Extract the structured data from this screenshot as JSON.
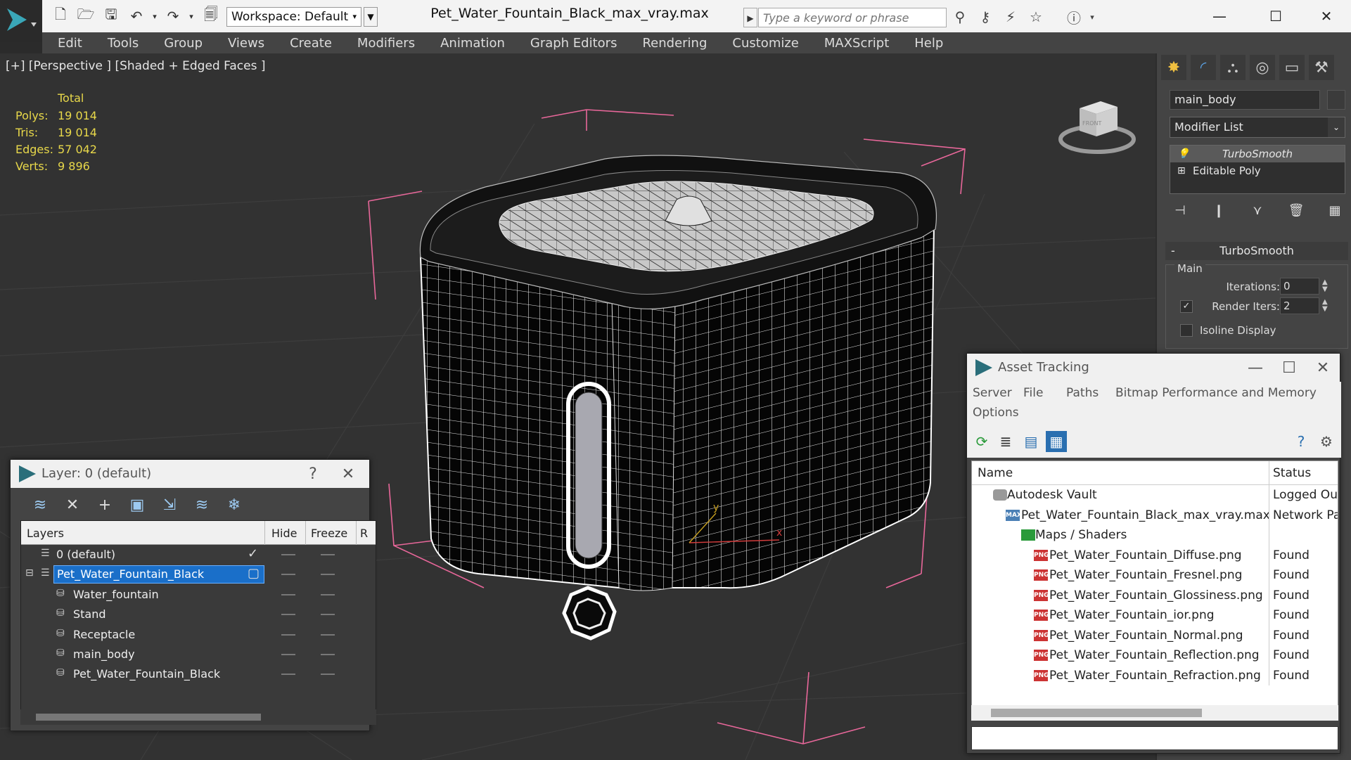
{
  "titlebar": {
    "workspace": "Workspace: Default",
    "document_title": "Pet_Water_Fountain_Black_max_vray.max",
    "search_placeholder": "Type a keyword or phrase"
  },
  "menubar": [
    "Edit",
    "Tools",
    "Group",
    "Views",
    "Create",
    "Modifiers",
    "Animation",
    "Graph Editors",
    "Rendering",
    "Customize",
    "MAXScript",
    "Help"
  ],
  "viewport": {
    "label": "[+] [Perspective ] [Shaded + Edged Faces ]",
    "stats": {
      "header": "Total",
      "rows": [
        {
          "k": "Polys:",
          "v": "19 014"
        },
        {
          "k": "Tris:",
          "v": "19 014"
        },
        {
          "k": "Edges:",
          "v": "57 042"
        },
        {
          "k": "Verts:",
          "v": "9 896"
        }
      ]
    },
    "viewcube_label": "FRONT",
    "axis_x": "x",
    "axis_y": "y",
    "colors": {
      "stats": "#e8d84a",
      "bbox": "#e8679a",
      "wire": "#ffffff"
    }
  },
  "command_panel": {
    "object_name": "main_body",
    "modifier_list": "Modifier List",
    "stack": [
      "TurboSmooth",
      "Editable Poly"
    ],
    "rollout_title": "TurboSmooth",
    "rollout_collapse": "-",
    "group": "Main",
    "iterations_label": "Iterations:",
    "iterations": "0",
    "render_iters_label": "Render Iters:",
    "render_iters": "2",
    "isoline_label": "Isoline Display"
  },
  "layer_dialog": {
    "title": "Layer: 0 (default)",
    "help": "?",
    "columns": {
      "layers": "Layers",
      "hide": "Hide",
      "freeze": "Freeze",
      "r": "R"
    },
    "rows": [
      {
        "name": "0 (default)",
        "indent": 0,
        "type": "layer",
        "current": true
      },
      {
        "name": "Pet_Water_Fountain_Black",
        "indent": 0,
        "type": "layer",
        "selected": true
      },
      {
        "name": "Water_fountain",
        "indent": 1,
        "type": "object"
      },
      {
        "name": "Stand",
        "indent": 1,
        "type": "object"
      },
      {
        "name": "Receptacle",
        "indent": 1,
        "type": "object"
      },
      {
        "name": "main_body",
        "indent": 1,
        "type": "object"
      },
      {
        "name": "Pet_Water_Fountain_Black",
        "indent": 1,
        "type": "object"
      }
    ]
  },
  "asset_dialog": {
    "title": "Asset Tracking",
    "menu": [
      "Server",
      "File",
      "Paths",
      "Bitmap Performance and Memory",
      "Options"
    ],
    "columns": {
      "name": "Name",
      "status": "Status"
    },
    "rows": [
      {
        "name": "Autodesk Vault",
        "status": "Logged Out",
        "indent": 1,
        "icon": "srv"
      },
      {
        "name": "Pet_Water_Fountain_Black_max_vray.max",
        "status": "Network Path",
        "indent": 2,
        "icon": "max"
      },
      {
        "name": "Maps / Shaders",
        "status": "",
        "indent": 3,
        "icon": "fld"
      },
      {
        "name": "Pet_Water_Fountain_Diffuse.png",
        "status": "Found",
        "indent": 4,
        "icon": "png"
      },
      {
        "name": "Pet_Water_Fountain_Fresnel.png",
        "status": "Found",
        "indent": 4,
        "icon": "png"
      },
      {
        "name": "Pet_Water_Fountain_Glossiness.png",
        "status": "Found",
        "indent": 4,
        "icon": "png"
      },
      {
        "name": "Pet_Water_Fountain_ior.png",
        "status": "Found",
        "indent": 4,
        "icon": "png"
      },
      {
        "name": "Pet_Water_Fountain_Normal.png",
        "status": "Found",
        "indent": 4,
        "icon": "png"
      },
      {
        "name": "Pet_Water_Fountain_Reflection.png",
        "status": "Found",
        "indent": 4,
        "icon": "png"
      },
      {
        "name": "Pet_Water_Fountain_Refraction.png",
        "status": "Found",
        "indent": 4,
        "icon": "png"
      }
    ]
  }
}
